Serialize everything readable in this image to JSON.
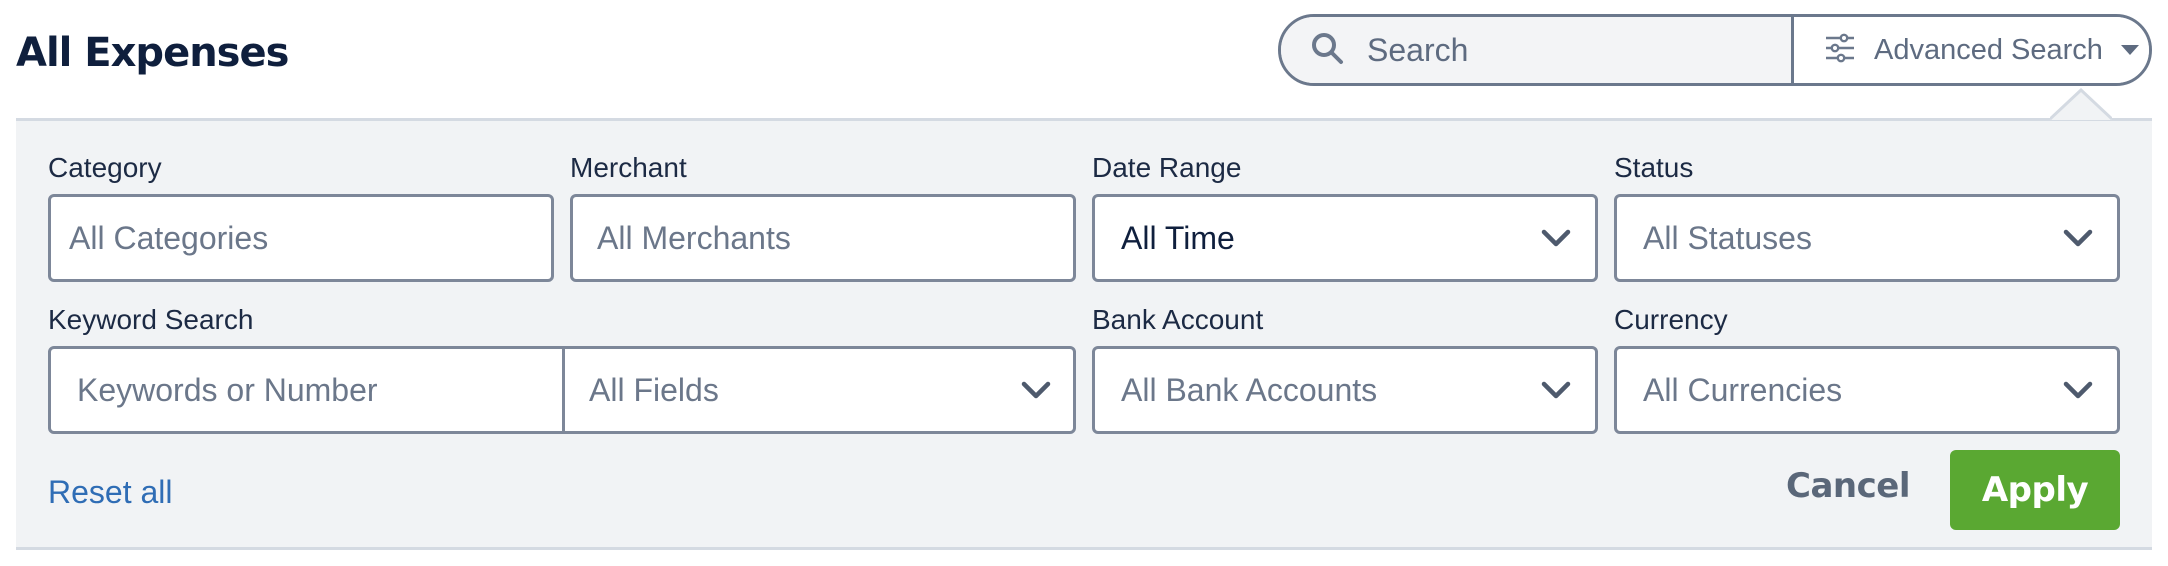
{
  "header": {
    "title": "All Expenses"
  },
  "search": {
    "placeholder": "Search",
    "advanced_label": "Advanced Search",
    "search_icon": "search-icon",
    "advanced_icon": "sliders-icon"
  },
  "filters": {
    "category": {
      "label": "Category",
      "placeholder": "All Categories"
    },
    "merchant": {
      "label": "Merchant",
      "placeholder": "All Merchants"
    },
    "date_range": {
      "label": "Date Range",
      "value": "All Time"
    },
    "status": {
      "label": "Status",
      "value": "All Statuses"
    },
    "keyword": {
      "label": "Keyword Search",
      "placeholder": "Keywords or Number",
      "field_value": "All Fields"
    },
    "bank_account": {
      "label": "Bank Account",
      "value": "All Bank Accounts"
    },
    "currency": {
      "label": "Currency",
      "value": "All Currencies"
    }
  },
  "actions": {
    "reset": "Reset all",
    "cancel": "Cancel",
    "apply": "Apply"
  },
  "colors": {
    "apply_bg": "#5aa832",
    "link": "#2f6db5",
    "panel_bg": "#f1f3f5",
    "border": "#7d8799"
  }
}
